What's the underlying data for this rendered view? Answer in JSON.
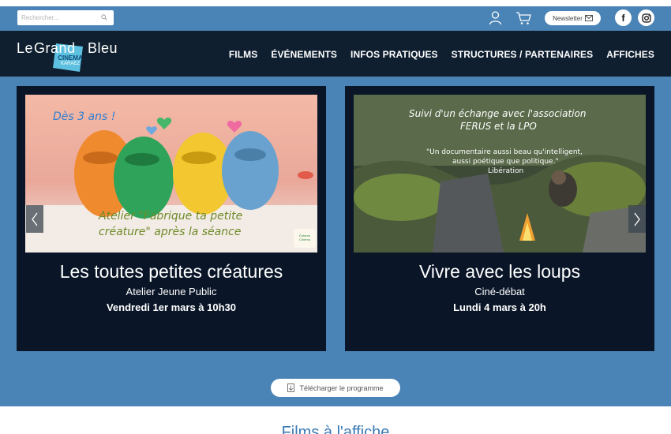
{
  "search": {
    "placeholder": "Rechercher..."
  },
  "util": {
    "newsletter_label": "Newsletter"
  },
  "logo": {
    "word1": "Le",
    "word2": "Grand",
    "word3": "Bleu",
    "cinema": "CINEMA",
    "city": "KARAEZ"
  },
  "nav": {
    "items": [
      "FILMS",
      "ÉVÉNEMENTS",
      "INFOS PRATIQUES",
      "STRUCTURES / PARTENAIRES",
      "AFFICHES"
    ]
  },
  "cards": [
    {
      "title": "Les toutes petites créatures",
      "subtitle": "Atelier Jeune Public",
      "date": "Vendredi 1er mars à 10h30",
      "img_age": "Dès 3 ans !",
      "img_line1": "Atelier \"Fabrique ta petite",
      "img_line2": "créature\" après la séance",
      "img_logo": "Enfants Cinéma"
    },
    {
      "title": "Vivre avec les loups",
      "subtitle": "Ciné-débat",
      "date": "Lundi 4 mars à 20h",
      "img_line1": "Suivi d'un échange avec l'association",
      "img_line2": "FERUS et la LPO",
      "img_quote1": "\"Un documentaire aussi beau qu'intelligent,",
      "img_quote2": "aussi poétique que politique.\"",
      "img_quote3": "Libération"
    }
  ],
  "download": {
    "label": "Télécharger le programme"
  },
  "section": {
    "title": "Films à l'affiche"
  },
  "colors": {
    "utilbar": "#4a83b5",
    "navbar": "#0f1f30",
    "card": "#0a1628",
    "accent": "#3a7ab5"
  }
}
